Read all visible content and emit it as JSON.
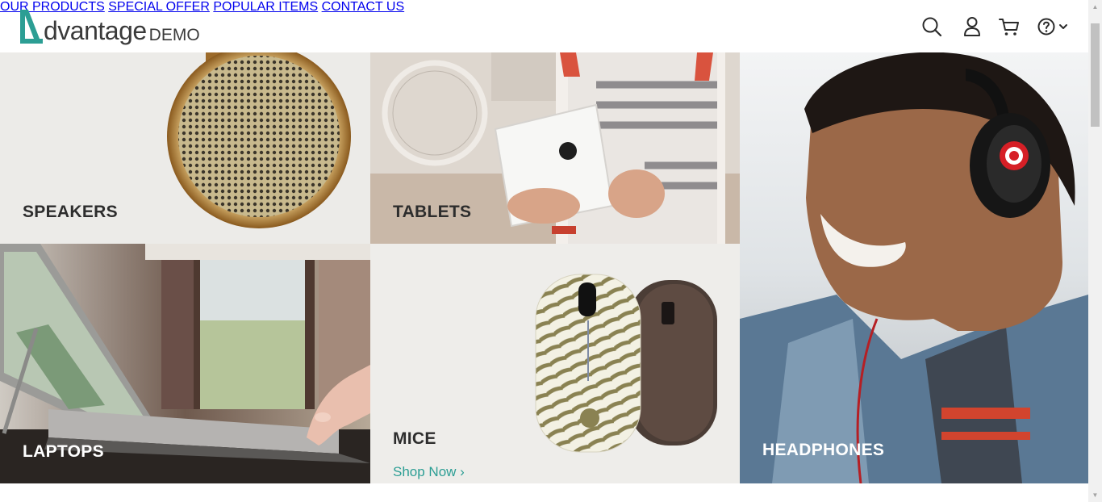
{
  "logo": {
    "text": "dvantage",
    "suffix": "DEMO"
  },
  "nav": [
    {
      "label": "OUR PRODUCTS"
    },
    {
      "label": "SPECIAL OFFER"
    },
    {
      "label": "POPULAR ITEMS"
    },
    {
      "label": "CONTACT US"
    }
  ],
  "icons": {
    "search": "search-icon",
    "user": "user-icon",
    "cart": "cart-icon",
    "help": "help-icon"
  },
  "categories": {
    "speakers": "SPEAKERS",
    "tablets": "TABLETS",
    "laptops": "LAPTOPS",
    "mice": "MICE",
    "headphones": "HEADPHONES"
  },
  "mice_link": "Shop Now",
  "colors": {
    "accent": "#2c9e94",
    "text": "#313131"
  }
}
